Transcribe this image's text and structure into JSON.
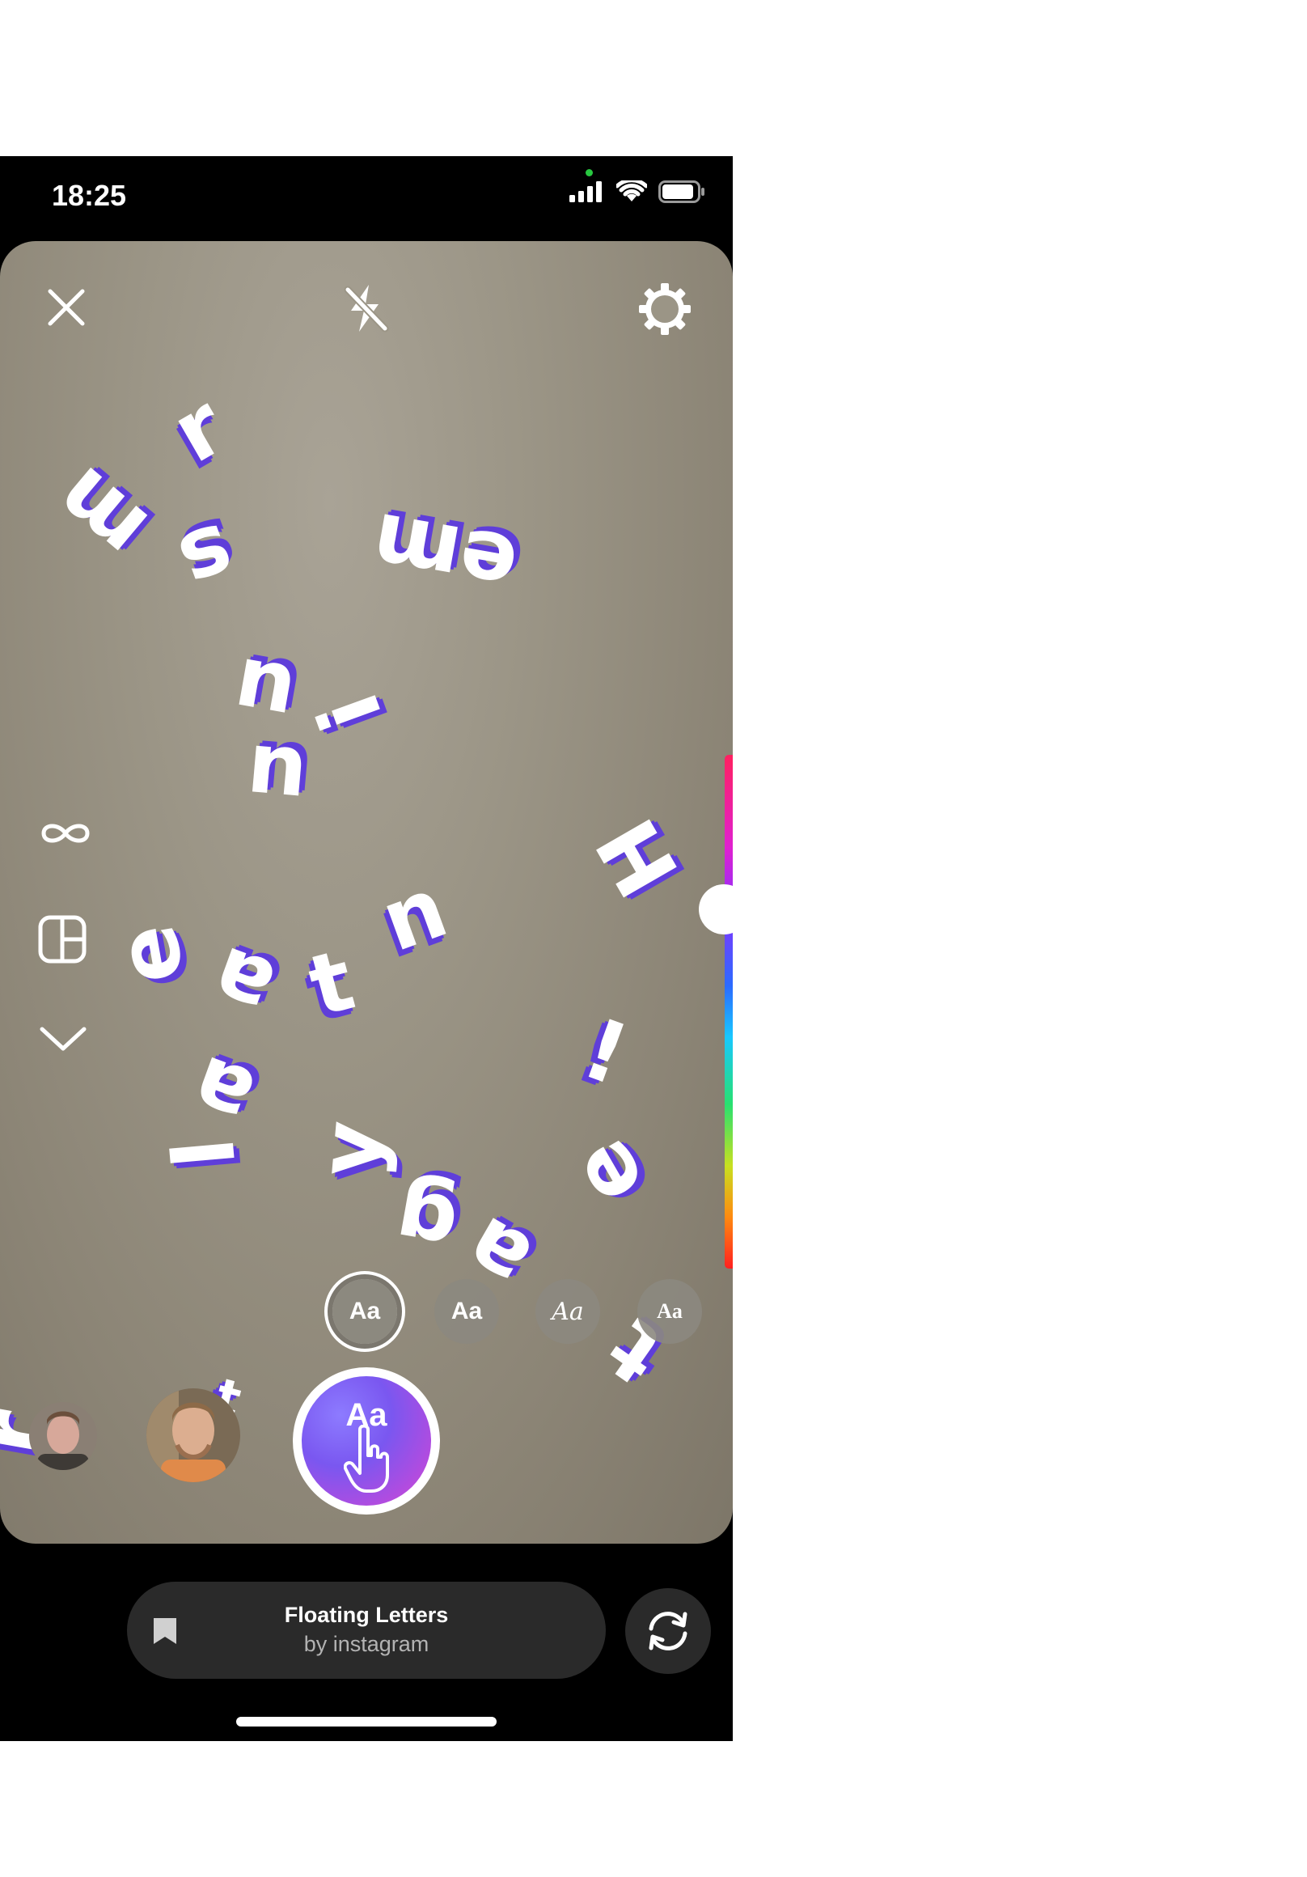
{
  "status_bar": {
    "time": "18:25"
  },
  "top_bar": {
    "close_icon": "close-icon",
    "flash_icon": "flash-off-icon",
    "settings_icon": "gear-icon"
  },
  "side_tools": [
    "infinity-icon",
    "layout-icon",
    "chevron-down-icon"
  ],
  "effect_letters": [
    "r",
    "m",
    "s",
    "em",
    "u",
    "i",
    "u",
    "H",
    "n",
    "e",
    "a",
    "t",
    "a",
    "l",
    "y",
    "!",
    "e",
    "g",
    "a",
    "t",
    "r",
    "t"
  ],
  "font_chips": [
    {
      "label": "Aa",
      "selected": true
    },
    {
      "label": "Aa",
      "selected": false
    },
    {
      "label": "Aa",
      "selected": false
    },
    {
      "label": "Aa",
      "selected": false
    }
  ],
  "capture_button": {
    "label": "Aa"
  },
  "effect_pill": {
    "title": "Floating Letters",
    "author": "by instagram"
  },
  "colors": {
    "accent_purple": "#5f3ed9",
    "pill_bg": "#2a2a2a"
  }
}
